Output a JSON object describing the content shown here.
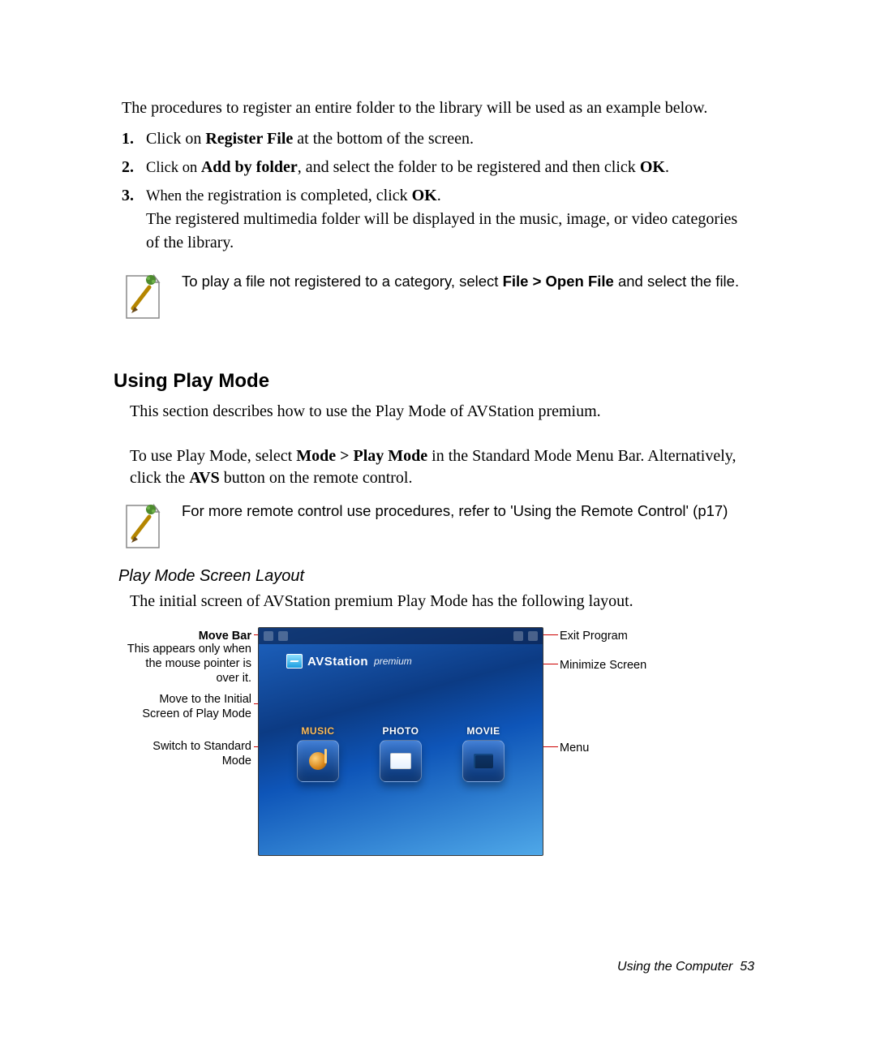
{
  "intro": "The procedures to register an entire folder to the library will be used as an example below.",
  "steps": [
    {
      "num": "1.",
      "pre": "Click on ",
      "bold": "Register File",
      "post": " at the bottom of the screen."
    },
    {
      "num": "2.",
      "lead": "Click on ",
      "bold": "Add by folder",
      "post": ", and select the folder to be registered and then click ",
      "bold2": "OK",
      "post2": "."
    },
    {
      "num": "3.",
      "lead": "When the ",
      "mid": "registration is completed, click ",
      "bold": "OK",
      "post": ".",
      "extra": "The registered multimedia folder will be displayed in the music, image, or video categories of the library."
    }
  ],
  "note1": {
    "pre": "To play a file not registered to a category, select ",
    "bold": "File > Open File",
    "post": " and select the file."
  },
  "section_title": "Using Play Mode",
  "section_p1": "This section describes how to use the Play Mode of AVStation premium.",
  "section_p2a": "To use Play Mode, select ",
  "section_p2_bold1": "Mode > Play Mode",
  "section_p2b": " in the Standard Mode Menu Bar. Alternatively, click the ",
  "section_p2_bold2": "AVS",
  "section_p2c": " button on the remote control.",
  "note2": "For more remote control use procedures, refer to 'Using the Remote Control' (p17)",
  "sub_title": "Play Mode Screen Layout",
  "sub_p": "The initial screen of AVStation premium Play Mode has the following layout.",
  "labels": {
    "move_bar": "Move Bar",
    "move_bar_desc": "This appears only when the mouse pointer is over it.",
    "initial": "Move to the Initial Screen of Play Mode",
    "standard": "Switch to Standard Mode",
    "exit": "Exit Program",
    "minimize": "Minimize Screen",
    "menu": "Menu"
  },
  "logo": {
    "name": "AVStation",
    "suffix": "premium"
  },
  "tiles": {
    "music": "MUSIC",
    "photo": "PHOTO",
    "movie": "MOVIE"
  },
  "footer": {
    "text": "Using the Computer",
    "page": "53"
  }
}
